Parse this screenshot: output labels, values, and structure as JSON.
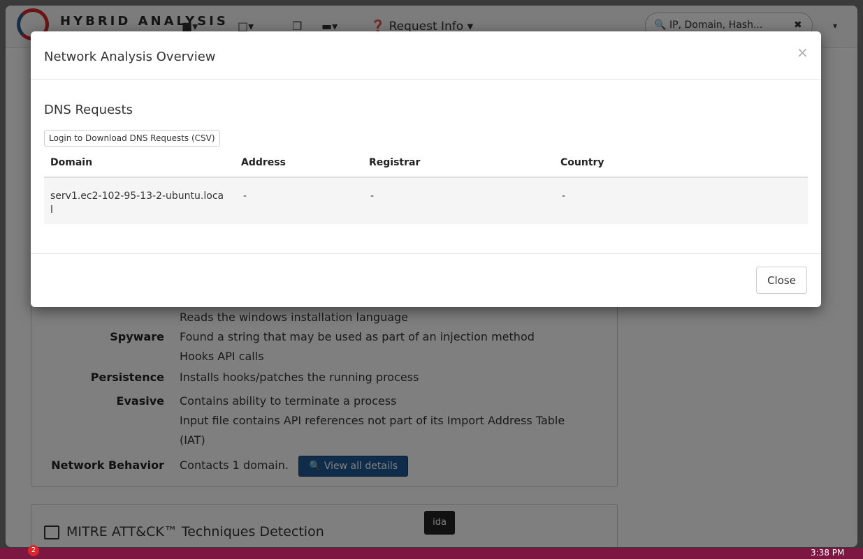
{
  "header": {
    "logo_text": "HYBRID ANALYSIS",
    "request_info": "Request Info",
    "search_placeholder": "IP, Domain, Hash..."
  },
  "background_panel": {
    "partial_line": "Reads the windows installation language",
    "rows": [
      {
        "label": "Spyware",
        "values": [
          "Found a string that may be used as part of an injection method",
          "Hooks API calls"
        ]
      },
      {
        "label": "Persistence",
        "values": [
          "Installs hooks/patches the running process"
        ]
      },
      {
        "label": "Evasive",
        "values": [
          "Contains ability to terminate a process",
          "Input file contains API references not part of its Import Address Table",
          "(IAT)"
        ]
      },
      {
        "label": "Network Behavior",
        "values": [
          "Contacts 1 domain."
        ]
      }
    ],
    "view_button": "View all details"
  },
  "mitre_panel": {
    "title": "MITRE ATT&CK™ Techniques Detection"
  },
  "tooltip": "ida",
  "modal": {
    "title": "Network Analysis Overview",
    "close_x": "×",
    "section_title": "DNS Requests",
    "download_button": "Login to Download DNS Requests (CSV)",
    "columns": [
      "Domain",
      "Address",
      "Registrar",
      "Country"
    ],
    "rows": [
      {
        "domain_line1": "serv1.ec2-102-95-13-2-ubuntu.loca",
        "domain_line2": "l",
        "address": "-",
        "registrar": "-",
        "country": "-"
      }
    ],
    "close_button": "Close"
  },
  "taskbar": {
    "badge": "2",
    "clock": "3:38 PM"
  }
}
